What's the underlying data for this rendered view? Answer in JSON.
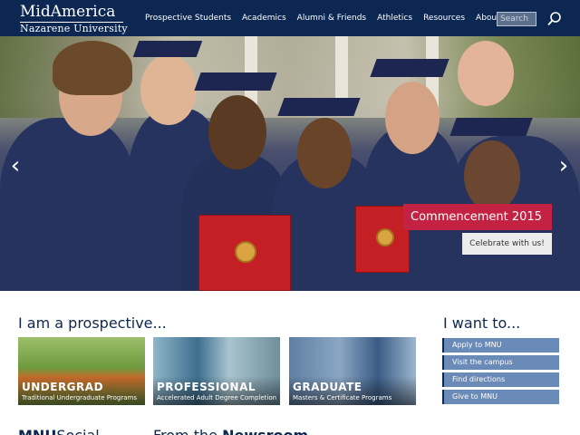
{
  "header": {
    "logo_line1": "MidAmerica",
    "logo_line2": "Nazarene University",
    "nav": [
      "Prospective Students",
      "Academics",
      "Alumni & Friends",
      "Athletics",
      "Resources",
      "About MNU"
    ],
    "search_placeholder": "Search",
    "colors": {
      "background": "#0c2752",
      "text": "#ffffff"
    }
  },
  "hero": {
    "caption_title": "Commencement 2015",
    "caption_button": "Celebrate with us!",
    "prev_arrow": "‹",
    "next_arrow": "›",
    "colors": {
      "caption": "#c42243",
      "button": "#ececec"
    }
  },
  "prospective": {
    "heading": "I am a prospective...",
    "tiles": [
      {
        "title": "UNDERGRAD",
        "subtitle": "Traditional Undergraduate Programs"
      },
      {
        "title": "PROFESSIONAL",
        "subtitle": "Accelerated Adult Degree Completion"
      },
      {
        "title": "GRADUATE",
        "subtitle": "Masters & Certificate Programs"
      }
    ]
  },
  "want": {
    "heading": "I want to...",
    "items": [
      "Apply to MNU",
      "Visit the campus",
      "Find directions",
      "Give to MNU"
    ],
    "colors": {
      "item": "#6a8ab7"
    }
  },
  "bottom": {
    "left_bold": "MNU",
    "left_rest": "Social",
    "right_prefix": "From the ",
    "right_bold": "Newsroom"
  }
}
